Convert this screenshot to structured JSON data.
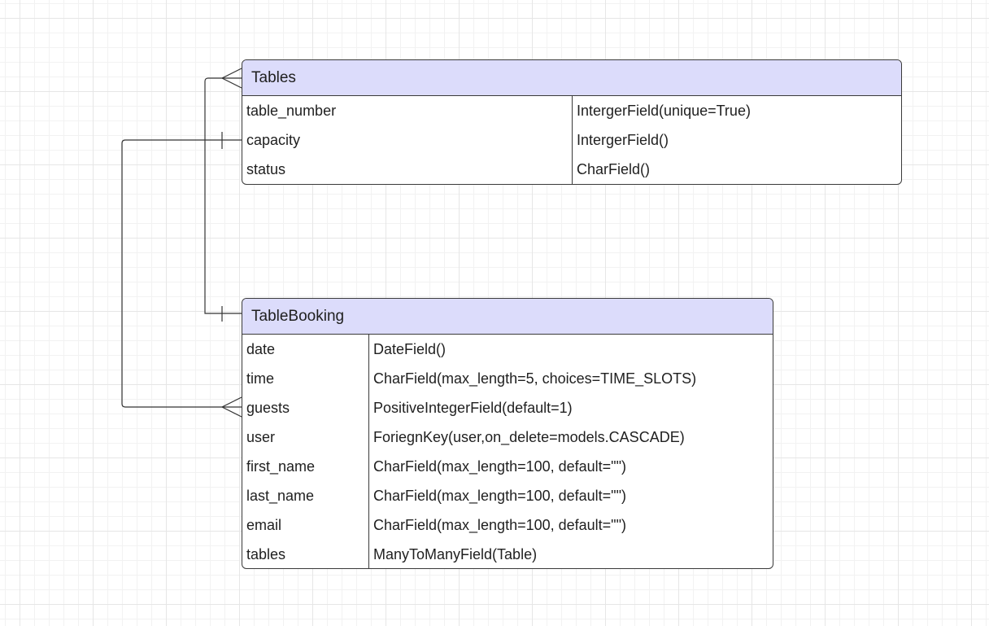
{
  "entities": {
    "tables": {
      "title": "Tables",
      "fields": [
        {
          "name": "table_number",
          "type": "IntergerField(unique=True)"
        },
        {
          "name": "capacity",
          "type": "IntergerField()"
        },
        {
          "name": "status",
          "type": "CharField()"
        }
      ]
    },
    "table_booking": {
      "title": "TableBooking",
      "fields": [
        {
          "name": "date",
          "type": "DateField()"
        },
        {
          "name": "time",
          "type": "CharField(max_length=5, choices=TIME_SLOTS)"
        },
        {
          "name": "guests",
          "type": "PositiveIntegerField(default=1)"
        },
        {
          "name": "user",
          "type": "ForiegnKey(user,on_delete=models.CASCADE)"
        },
        {
          "name": "first_name",
          "type": "CharField(max_length=100, default=\"\")"
        },
        {
          "name": "last_name",
          "type": "CharField(max_length=100, default=\"\")"
        },
        {
          "name": "email",
          "type": "CharField(max_length=100, default=\"\")"
        },
        {
          "name": "tables",
          "type": "ManyToManyField(Table)"
        }
      ]
    }
  },
  "colors": {
    "header_fill": "#dcdcfb",
    "border": "#3a3a3a",
    "connector": "#333333"
  }
}
